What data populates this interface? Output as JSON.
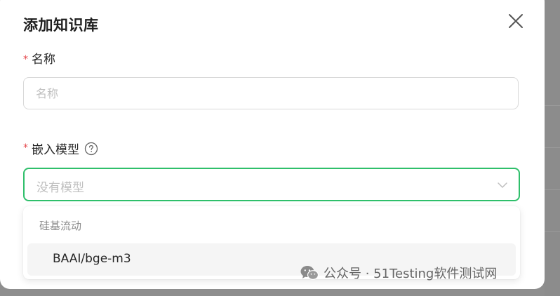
{
  "dialog": {
    "title": "添加知识库",
    "close_icon": "close-icon"
  },
  "name_field": {
    "required_mark": "*",
    "label": "名称",
    "placeholder": "名称",
    "value": ""
  },
  "model_field": {
    "required_mark": "*",
    "label": "嵌入模型",
    "help_icon": "question-circle-icon",
    "placeholder": "没有模型",
    "chevron_icon": "chevron-down-icon"
  },
  "dropdown": {
    "group_label": "硅基流动",
    "options": [
      {
        "label": "BAAI/bge-m3"
      }
    ]
  },
  "watermark": {
    "icon": "wechat-icon",
    "text": "公众号 · 51Testing软件测试网"
  },
  "colors": {
    "accent": "#2fbf6b",
    "required": "#e5484d",
    "backdrop": "#8e8e8e"
  }
}
